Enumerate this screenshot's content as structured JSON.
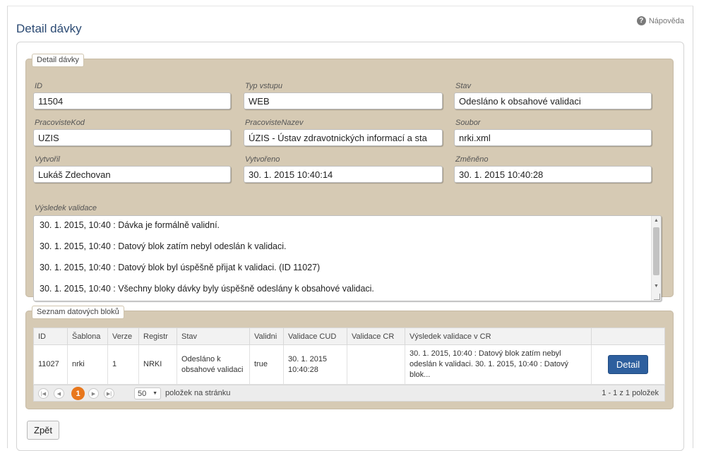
{
  "page": {
    "title": "Detail dávky",
    "help_label": "Nápověda"
  },
  "detail_panel": {
    "legend": "Detail dávky",
    "fields": {
      "id": {
        "label": "ID",
        "value": "11504"
      },
      "typ_vstupu": {
        "label": "Typ vstupu",
        "value": "WEB"
      },
      "stav": {
        "label": "Stav",
        "value": "Odesláno k obsahové validaci"
      },
      "pracoviste_kod": {
        "label": "PracovisteKod",
        "value": "UZIS"
      },
      "pracoviste_nazev": {
        "label": "PracovisteNazev",
        "value": "ÚZIS - Ústav zdravotnických informací a sta"
      },
      "soubor": {
        "label": "Soubor",
        "value": "nrki.xml"
      },
      "vytvoril": {
        "label": "Vytvořil",
        "value": "Lukáš Zdechovan"
      },
      "vytvoreno": {
        "label": "Vytvořeno",
        "value": "30. 1. 2015 10:40:14"
      },
      "zmeneno": {
        "label": "Změněno",
        "value": "30. 1. 2015 10:40:28"
      }
    },
    "validation": {
      "label": "Výsledek validace",
      "lines": [
        "30. 1. 2015, 10:40 : Dávka je formálně validní.",
        "30. 1. 2015, 10:40 : Datový blok zatím nebyl odeslán k validaci.",
        "30. 1. 2015, 10:40 : Datový blok byl úspěšně přijat k validaci. (ID 11027)",
        "30. 1. 2015, 10:40 : Všechny bloky dávky byly úspěšně odeslány k obsahové validaci."
      ]
    }
  },
  "blocks_panel": {
    "legend": "Seznam datových bloků",
    "columns": [
      "ID",
      "Šablona",
      "Verze",
      "Registr",
      "Stav",
      "Validni",
      "Validace CUD",
      "Validace CR",
      "Výsledek validace v CR",
      ""
    ],
    "rows": [
      {
        "id": "11027",
        "sablona": "nrki",
        "verze": "1",
        "registr": "NRKI",
        "stav": "Odesláno k obsahové validaci",
        "validni": "true",
        "validace_cud": "30. 1. 2015 10:40:28",
        "validace_cr": "",
        "vysledek": "30. 1. 2015, 10:40 : Datový blok zatím nebyl odeslán k validaci. 30. 1. 2015, 10:40 : Datový blok...",
        "action_label": "Detail"
      }
    ],
    "pager": {
      "current_page": "1",
      "page_size": "50",
      "per_page_label": "položek na stránku",
      "range_label": "1 - 1 z 1 položek"
    }
  },
  "footer": {
    "back_label": "Zpět"
  },
  "icons": {
    "help": "question-circle-icon",
    "first": "first-page-icon",
    "prev": "prev-page-icon",
    "next": "next-page-icon",
    "last": "last-page-icon",
    "dropdown": "chevron-down-icon"
  },
  "colors": {
    "panel_bg": "#d6cab4",
    "title": "#2b4a73",
    "button": "#2e5f9e",
    "pager_current": "#e8771c"
  }
}
